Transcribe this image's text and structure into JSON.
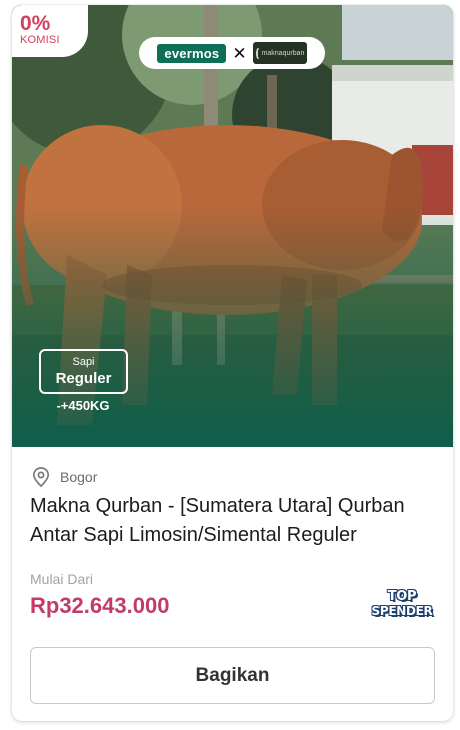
{
  "commission": {
    "percent": "0%",
    "label": "KOMISI"
  },
  "brand": {
    "partner_a": "evermos",
    "separator": "✕",
    "partner_b": "maknaqurban"
  },
  "badge": {
    "type_small": "Sapi",
    "type_big": "Reguler",
    "weight": "-+450KG"
  },
  "product": {
    "location_icon": "map-pin-icon",
    "location": "Bogor",
    "title": "Makna Qurban - [Sumatera Utara] Qurban Antar Sapi Limosin/Simental Reguler",
    "price_label": "Mulai Dari",
    "price": "Rp32.643.000"
  },
  "top_spender": {
    "line1": "TOP",
    "line2": "SPENDER"
  },
  "share_button": {
    "label": "Bagikan"
  },
  "colors": {
    "accent": "#c23b6b",
    "brand_green": "#0d6f57",
    "komisi": "#d4415b"
  }
}
